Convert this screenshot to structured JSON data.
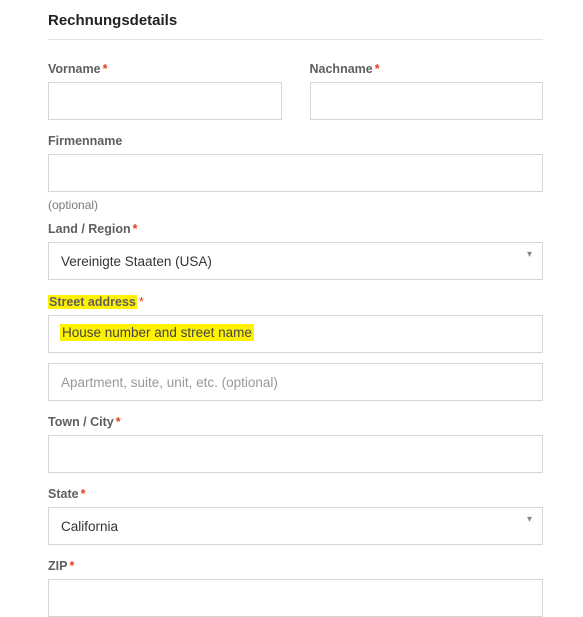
{
  "section_title": "Rechnungsdetails",
  "required_mark": "*",
  "fields": {
    "first_name": {
      "label": "Vorname",
      "value": ""
    },
    "last_name": {
      "label": "Nachname",
      "value": ""
    },
    "company": {
      "label": "Firmenname",
      "helper": "(optional)",
      "value": ""
    },
    "country": {
      "label": "Land / Region",
      "value": "Vereinigte Staaten (USA)"
    },
    "street": {
      "label": "Street address",
      "placeholder1": "House number and street name",
      "placeholder2": "Apartment, suite, unit, etc. (optional)",
      "value1": "",
      "value2": ""
    },
    "city": {
      "label": "Town / City",
      "value": ""
    },
    "state": {
      "label": "State",
      "value": "California"
    },
    "zip": {
      "label": "ZIP",
      "value": ""
    }
  }
}
